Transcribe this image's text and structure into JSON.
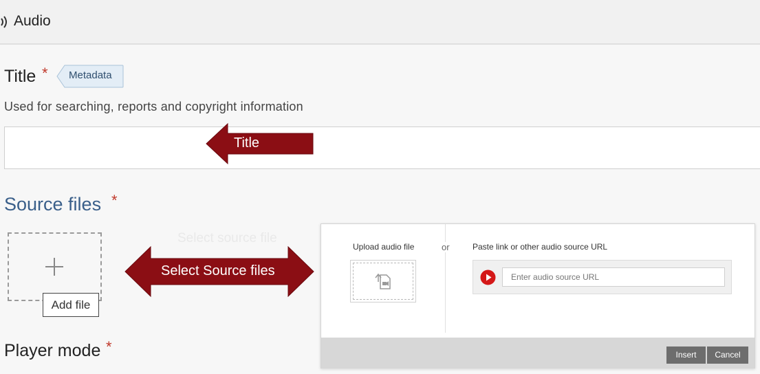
{
  "header": {
    "title": "Audio",
    "icon": "audio-waves-icon"
  },
  "title_field": {
    "label": "Title",
    "required_mark": "*",
    "tag": "Metadata",
    "description": "Used for searching, reports and copyright information",
    "value": "",
    "annotation": "Title"
  },
  "source_files": {
    "label": "Source files",
    "required_mark": "*",
    "add_tooltip": "Add file",
    "faint_text": "Select source file",
    "annotation": "Select Source files"
  },
  "player_mode": {
    "label": "Player mode",
    "required_mark": "*"
  },
  "dialog": {
    "upload_label": "Upload audio file",
    "or": "or",
    "paste_label": "Paste link or other audio source URL",
    "url_placeholder": "Enter audio source URL",
    "insert": "Insert",
    "cancel": "Cancel"
  },
  "colors": {
    "arrow": "#8b0e14",
    "accent_blue": "#3a5f8a",
    "required": "#c0392b",
    "play": "#d41818"
  }
}
